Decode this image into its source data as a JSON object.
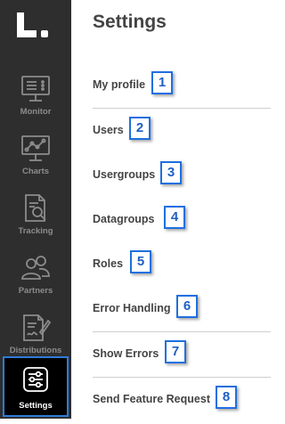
{
  "app": {
    "logo_text": "L."
  },
  "sidebar": {
    "items": [
      {
        "label": "Monitor",
        "icon": "monitor-icon"
      },
      {
        "label": "Charts",
        "icon": "chart-icon"
      },
      {
        "label": "Tracking",
        "icon": "tracking-icon"
      },
      {
        "label": "Partners",
        "icon": "partners-icon"
      },
      {
        "label": "Distributions",
        "icon": "distributions-icon"
      },
      {
        "label": "Settings",
        "icon": "settings-icon",
        "active": true
      }
    ]
  },
  "page": {
    "title": "Settings"
  },
  "menu": [
    {
      "label": "My profile",
      "badge": "1"
    },
    {
      "label": "Users",
      "badge": "2"
    },
    {
      "label": "Usergroups",
      "badge": "3"
    },
    {
      "label": "Datagroups",
      "badge": "4"
    },
    {
      "label": "Roles",
      "badge": "5"
    },
    {
      "label": "Error Handling",
      "badge": "6"
    },
    {
      "label": "Show Errors",
      "badge": "7"
    },
    {
      "label": "Send Feature Request",
      "badge": "8"
    }
  ],
  "colors": {
    "sidebar_bg": "#2e2e2e",
    "active_outline": "#2f7bd6",
    "badge_border": "#1f6fe0",
    "text": "#444444"
  }
}
